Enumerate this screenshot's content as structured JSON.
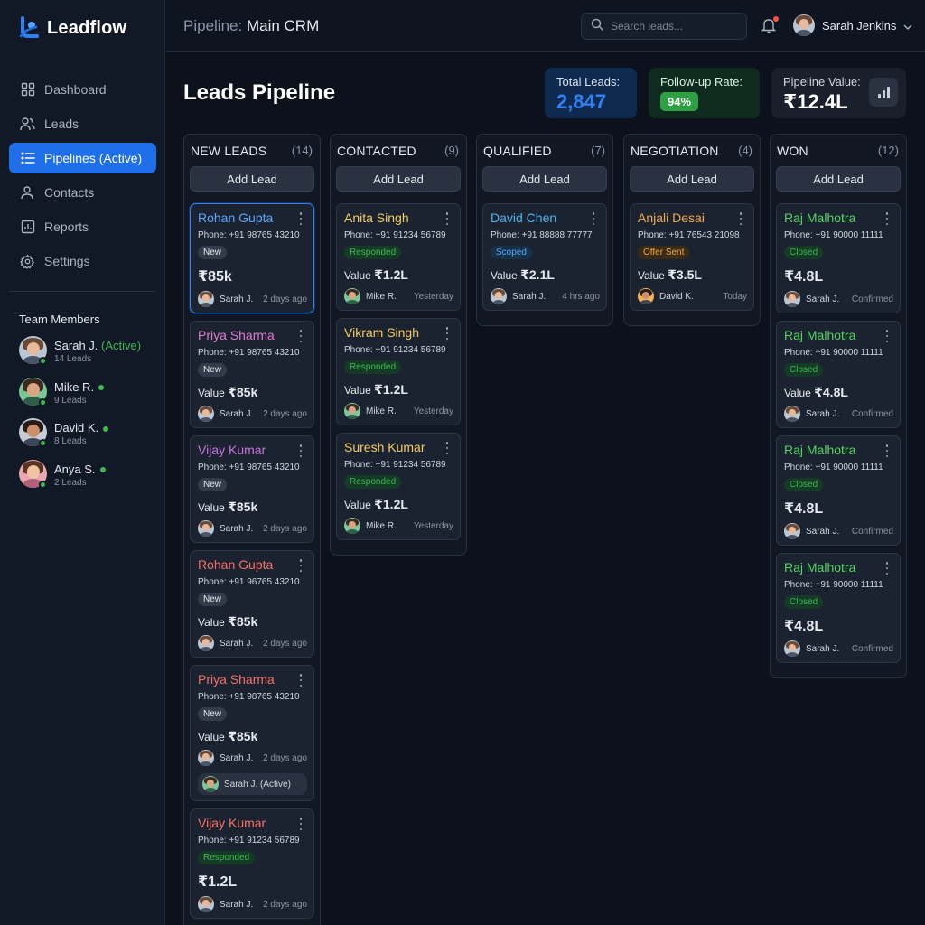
{
  "brand": {
    "name": "Leadflow"
  },
  "nav": [
    {
      "label": "Dashboard",
      "icon": "grid-icon"
    },
    {
      "label": "Leads",
      "icon": "users-icon"
    },
    {
      "label": "Pipelines (Active)",
      "icon": "list-icon",
      "active": true
    },
    {
      "label": "Contacts",
      "icon": "contacts-icon"
    },
    {
      "label": "Reports",
      "icon": "bar-chart-icon"
    },
    {
      "label": "Settings",
      "icon": "gear-icon"
    }
  ],
  "team": {
    "title": "Team Members",
    "members": [
      {
        "name": "Sarah J.",
        "status_label": "(Active)",
        "leads": "14 Leads"
      },
      {
        "name": "Mike R.",
        "leads": "9 Leads"
      },
      {
        "name": "David K.",
        "leads": "8 Leads"
      },
      {
        "name": "Anya S.",
        "leads": "2 Leads"
      }
    ]
  },
  "header": {
    "breadcrumb_prefix": "Pipeline:",
    "breadcrumb_name": "Main CRM",
    "search_placeholder": "Search leads...",
    "user_name": "Sarah Jenkins"
  },
  "page": {
    "title": "Leads Pipeline"
  },
  "stats": {
    "total_label": "Total Leads:",
    "total_value": "2,847",
    "followup_label": "Follow-up Rate:",
    "followup_value": "94%",
    "pipeline_label": "Pipeline Value:",
    "pipeline_value": "₹12.4L"
  },
  "columns": [
    {
      "title": "NEW LEADS",
      "count": "(14)",
      "add_label": "Add Lead",
      "cards": [
        {
          "name": "Rohan Gupta",
          "phone": "Phone: +91 98765 43210",
          "badge": "New",
          "value_prefix": "",
          "value": "₹85k",
          "owner": "Sarah J.",
          "when": "2 days ago"
        },
        {
          "name": "Priya Sharma",
          "phone": "Phone: +91 98765 43210",
          "badge": "New",
          "value_prefix": "Value",
          "value": "₹85k",
          "owner": "Sarah J.",
          "when": "2 days ago"
        },
        {
          "name": "Vijay Kumar",
          "phone": "Phone: +91 98765 43210",
          "badge": "New",
          "value_prefix": "Value",
          "value": "₹85k",
          "owner": "Sarah J.",
          "when": "2 days ago"
        },
        {
          "name": "Rohan Gupta",
          "phone": "Phone: +91 96765 43210",
          "badge": "New",
          "value_prefix": "Value",
          "value": "₹85k",
          "owner": "Sarah J.",
          "when": "2 days ago"
        },
        {
          "name": "Priya Sharma",
          "phone": "Phone: +91 98765 43210",
          "badge": "New",
          "value_prefix": "Value",
          "value": "₹85k",
          "owner": "Sarah J.",
          "when": "2 days ago",
          "extra": "Sarah J. (Active)"
        },
        {
          "name": "Vijay Kumar",
          "phone": "Phone: +91 91234 56789",
          "badge": "Responded",
          "value_prefix": "",
          "value": "₹1.2L",
          "owner": "Sarah J.",
          "when": "2 days ago"
        }
      ]
    },
    {
      "title": "CONTACTED",
      "count": "(9)",
      "add_label": "Add Lead",
      "cards": [
        {
          "name": "Anita Singh",
          "phone": "Phone: +91 91234 56789",
          "badge": "Responded",
          "value_prefix": "Value",
          "value": "₹1.2L",
          "owner": "Mike R.",
          "when": "Yesterday"
        },
        {
          "name": "Vikram Singh",
          "phone": "Phone: +91 91234 56789",
          "badge": "Responded",
          "value_prefix": "Value",
          "value": "₹1.2L",
          "owner": "Mike R.",
          "when": "Yesterday"
        },
        {
          "name": "Suresh Kumar",
          "phone": "Phone: +91 91234 56789",
          "badge": "Responded",
          "value_prefix": "Value",
          "value": "₹1.2L",
          "owner": "Mike R.",
          "when": "Yesterday"
        }
      ]
    },
    {
      "title": "QUALIFIED",
      "count": "(7)",
      "add_label": "Add Lead",
      "cards": [
        {
          "name": "David Chen",
          "phone": "Phone: +91 88888 77777",
          "badge": "Scoped",
          "value_prefix": "Value",
          "value": "₹2.1L",
          "owner": "Sarah J.",
          "when": "4 hrs ago"
        }
      ]
    },
    {
      "title": "NEGOTIATION",
      "count": "(4)",
      "add_label": "Add Lead",
      "cards": [
        {
          "name": "Anjali Desai",
          "phone": "Phone: +91 76543 21098",
          "badge": "Offer Sent",
          "value_prefix": "Value",
          "value": "₹3.5L",
          "owner": "David K.",
          "when": "Today"
        }
      ]
    },
    {
      "title": "WON",
      "count": "(12)",
      "add_label": "Add Lead",
      "cards": [
        {
          "name": "Raj Malhotra",
          "phone": "Phone: +91 90000 11111",
          "badge": "Closed",
          "value_prefix": "",
          "value": "₹4.8L",
          "owner": "Sarah J.",
          "when": "Confirmed"
        },
        {
          "name": "Raj Malhotra",
          "phone": "Phone: +91 90000 11111",
          "badge": "Closed",
          "value_prefix": "Value",
          "value": "₹4.8L",
          "owner": "Sarah J.",
          "when": "Confirmed"
        },
        {
          "name": "Raj Malhotra",
          "phone": "Phone: +91 90000 11111",
          "badge": "Closed",
          "value_prefix": "",
          "value": "₹4.8L",
          "owner": "Sarah J.",
          "when": "Confirmed"
        },
        {
          "name": "Raj Malhotra",
          "phone": "Phone: +91 90000 11111",
          "badge": "Closed",
          "value_prefix": "",
          "value": "₹4.8L",
          "owner": "Sarah J.",
          "when": "Confirmed"
        }
      ]
    }
  ],
  "colors": {
    "accent": "#1f6feb",
    "success": "#3fb950",
    "name_blue": "#58a6ff",
    "name_pink": "#e07ad1",
    "name_purple": "#c678dd",
    "name_red": "#f47067",
    "name_yellow": "#f2cc60",
    "name_cyan": "#4fb3f0",
    "name_orange": "#f0a94b",
    "name_green": "#56d364"
  }
}
